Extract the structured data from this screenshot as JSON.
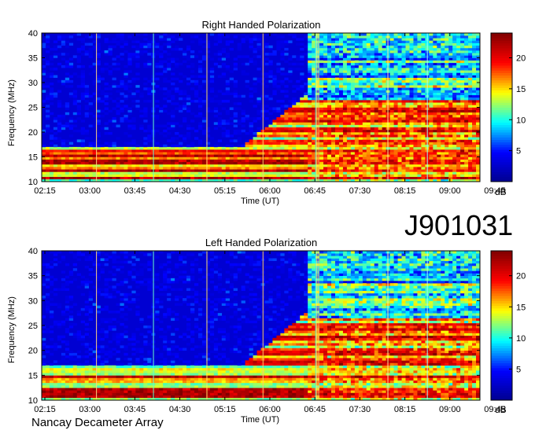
{
  "big_label": "J901031",
  "footer": "Nancay Decameter Array",
  "chart_data": [
    {
      "type": "heatmap",
      "title": "Right Handed Polarization",
      "xlabel": "Time (UT)",
      "ylabel": "Frequency (MHz)",
      "x_ticks": [
        "02:15",
        "03:00",
        "03:45",
        "04:30",
        "05:15",
        "06:00",
        "06:45",
        "07:30",
        "08:15",
        "09:00",
        "09:45"
      ],
      "y_ticks": [
        10,
        15,
        20,
        25,
        30,
        35,
        40
      ],
      "ylim": [
        10,
        40
      ],
      "colorbar_label": "dB",
      "colorbar_ticks": [
        5,
        10,
        15,
        20
      ],
      "color_range": [
        0,
        24
      ],
      "colormap": [
        "#00008f",
        "#0000ff",
        "#00ffff",
        "#ffff00",
        "#ff0000",
        "#800000"
      ]
    },
    {
      "type": "heatmap",
      "title": "Left Handed Polarization",
      "xlabel": "Time (UT)",
      "ylabel": "Frequency (MHz)",
      "x_ticks": [
        "02:15",
        "03:00",
        "03:45",
        "04:30",
        "05:15",
        "06:00",
        "06:45",
        "07:30",
        "08:15",
        "09:00",
        "09:45"
      ],
      "y_ticks": [
        10,
        15,
        20,
        25,
        30,
        35,
        40
      ],
      "ylim": [
        10,
        40
      ],
      "colorbar_label": "dB",
      "colorbar_ticks": [
        5,
        10,
        15,
        20
      ],
      "color_range": [
        0,
        24
      ],
      "colormap": [
        "#00008f",
        "#0000ff",
        "#00ffff",
        "#ffff00",
        "#ff0000",
        "#800000"
      ]
    }
  ]
}
